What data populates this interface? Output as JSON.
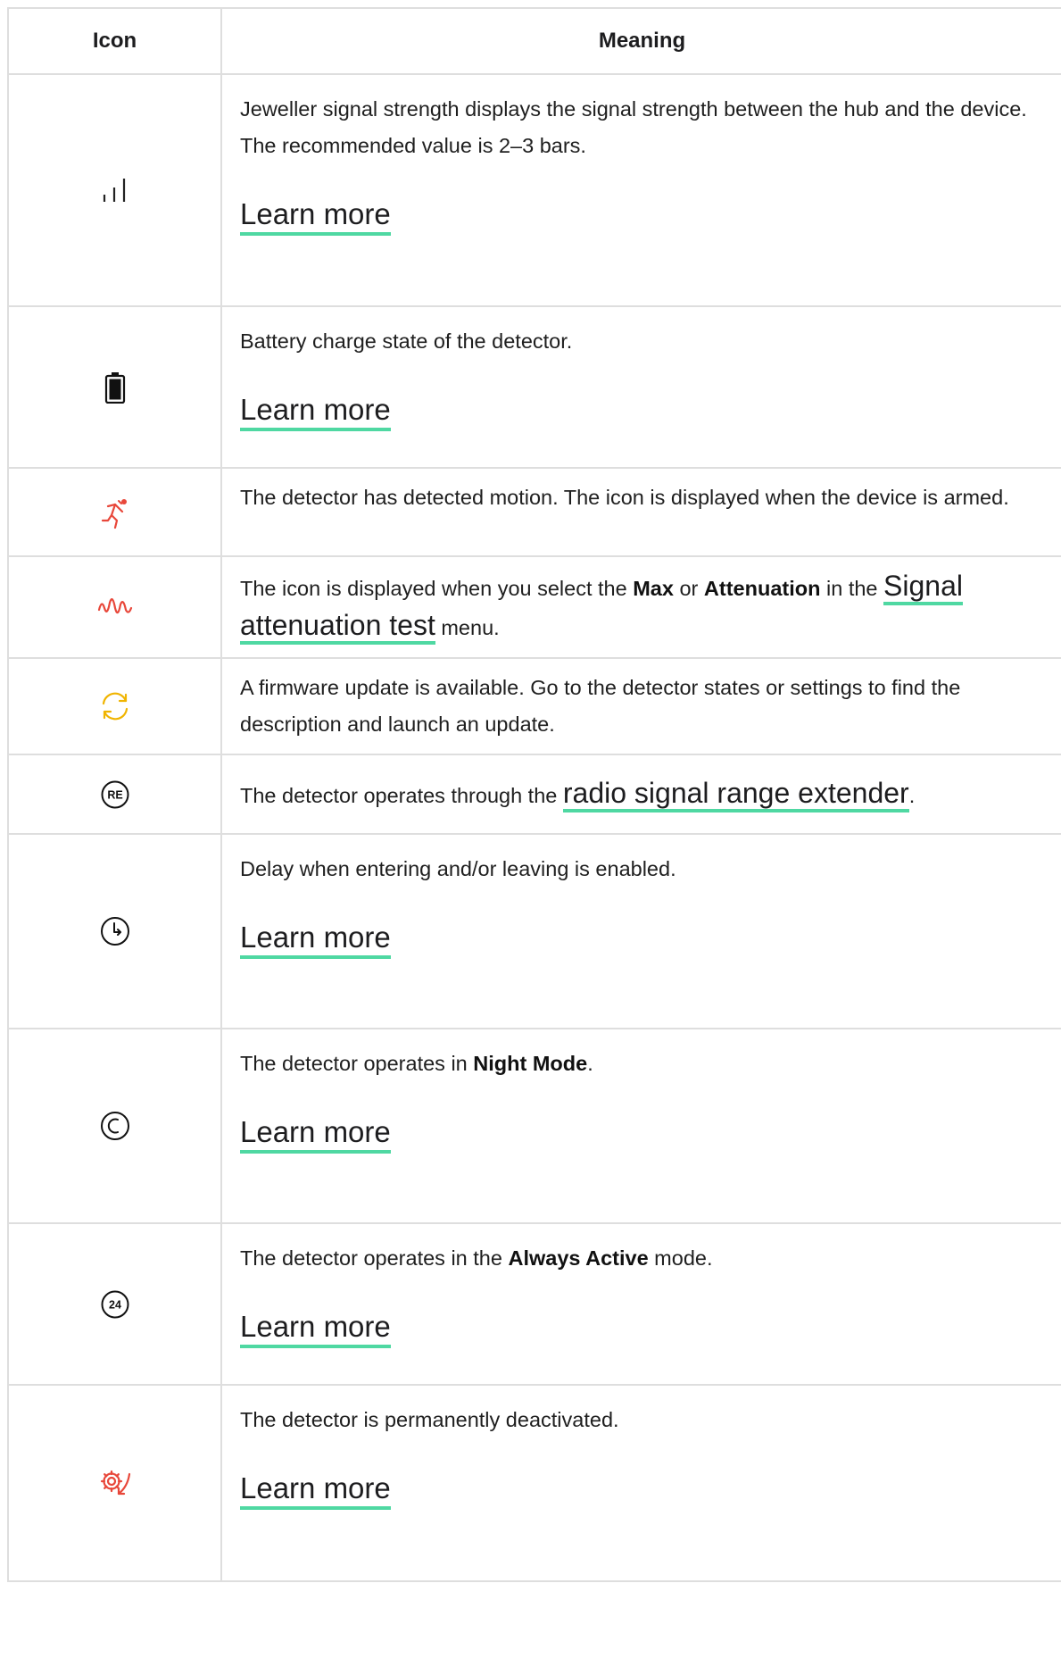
{
  "header": {
    "icon": "Icon",
    "meaning": "Meaning"
  },
  "learn_more": "Learn more",
  "colors": {
    "red": "#e8473a",
    "orange": "#f0b400",
    "accent": "#4fd8a2",
    "border": "#dedede"
  },
  "rows": [
    {
      "icon": "signal-strength-icon",
      "text": "Jeweller signal strength displays the signal strength between the hub and the device. The recommended value is 2–3 bars."
    },
    {
      "icon": "battery-icon",
      "text": "Battery charge state of the detector."
    },
    {
      "icon": "motion-detected-icon",
      "text": "The detector has detected motion. The icon is displayed when the device is armed."
    },
    {
      "icon": "signal-wave-icon",
      "pre": "The icon is displayed when you select the ",
      "b1": "Max",
      "mid": " or ",
      "b2": "Attenuation",
      "post": " in the ",
      "link": "Signal attenuation test",
      "tail": " menu."
    },
    {
      "icon": "firmware-update-icon",
      "text": "A firmware update is available. Go to the detector states or settings to find the description and launch an update."
    },
    {
      "icon": "range-extender-icon",
      "icon_text": "RE",
      "pre": "The detector operates through the ",
      "link": "radio signal range extender",
      "tail": "."
    },
    {
      "icon": "delay-clock-icon",
      "text": "Delay when entering and/or leaving is enabled."
    },
    {
      "icon": "night-mode-icon",
      "pre": "The detector operates in ",
      "b1": "Night Mode",
      "tail": "."
    },
    {
      "icon": "always-active-icon",
      "icon_text": "24",
      "pre": "The detector operates in the ",
      "b1": "Always Active",
      "tail": " mode."
    },
    {
      "icon": "deactivated-icon",
      "text": "The detector is permanently deactivated."
    }
  ]
}
